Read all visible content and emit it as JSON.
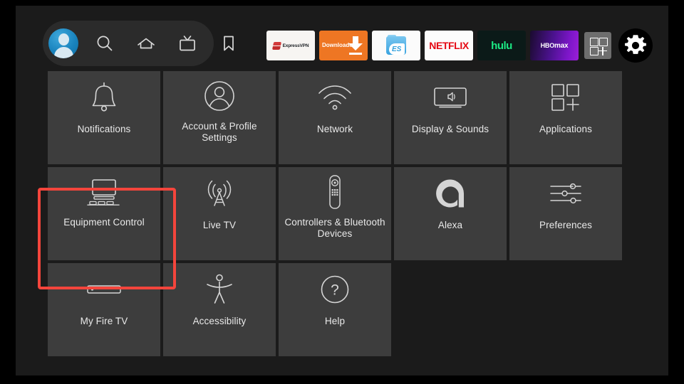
{
  "header": {
    "nav_icons": [
      {
        "name": "profile-avatar",
        "label": "Profile"
      },
      {
        "name": "search-icon",
        "label": "Search"
      },
      {
        "name": "home-icon",
        "label": "Home"
      },
      {
        "name": "live-tv-icon",
        "label": "Live TV"
      },
      {
        "name": "bookmark-icon",
        "label": "Your Stuff"
      }
    ],
    "apps": [
      {
        "name": "app-expressvpn",
        "label": "ExpressVPN",
        "bg": "#f7f5f2"
      },
      {
        "name": "app-downloader",
        "label": "Downloader",
        "bg": "#ee7623"
      },
      {
        "name": "app-es-file-explorer",
        "label": "ES",
        "bg": "#fbfbfb"
      },
      {
        "name": "app-netflix",
        "label": "NETFLIX",
        "bg": "#fcfcfc"
      },
      {
        "name": "app-hulu",
        "label": "hulu",
        "bg": "#0b1a18"
      },
      {
        "name": "app-hbomax",
        "label_prefix": "HB",
        "label_mid": "O",
        "label_suffix": "max",
        "label": "HBOmax",
        "bg": "#7d16c9"
      }
    ],
    "apps_button": "grid-plus-icon",
    "settings_button": "gear-icon"
  },
  "grid": {
    "rows": [
      [
        {
          "label": "Notifications",
          "icon": "bell-icon"
        },
        {
          "label": "Account & Profile Settings",
          "icon": "account-profile-icon"
        },
        {
          "label": "Network",
          "icon": "wifi-icon"
        },
        {
          "label": "Display & Sounds",
          "icon": "display-sounds-icon"
        },
        {
          "label": "Applications",
          "icon": "applications-icon"
        }
      ],
      [
        {
          "label": "Equipment Control",
          "icon": "equipment-control-icon"
        },
        {
          "label": "Live TV",
          "icon": "antenna-icon"
        },
        {
          "label": "Controllers & Bluetooth Devices",
          "icon": "remote-control-icon"
        },
        {
          "label": "Alexa",
          "icon": "alexa-icon"
        },
        {
          "label": "Preferences",
          "icon": "sliders-icon"
        }
      ],
      [
        {
          "label": "My Fire TV",
          "icon": "fire-tv-stick-icon"
        },
        {
          "label": "Accessibility",
          "icon": "accessibility-icon"
        },
        {
          "label": "Help",
          "icon": "help-question-icon"
        }
      ]
    ],
    "highlighted_tile": "My Fire TV",
    "highlight_color": "#f4453c"
  },
  "colors": {
    "background": "#1b1b1b",
    "tile": "#3d3d3d",
    "text": "#e9e9e9",
    "accent": "#f4453c",
    "avatar_blue": "#1983bd"
  }
}
